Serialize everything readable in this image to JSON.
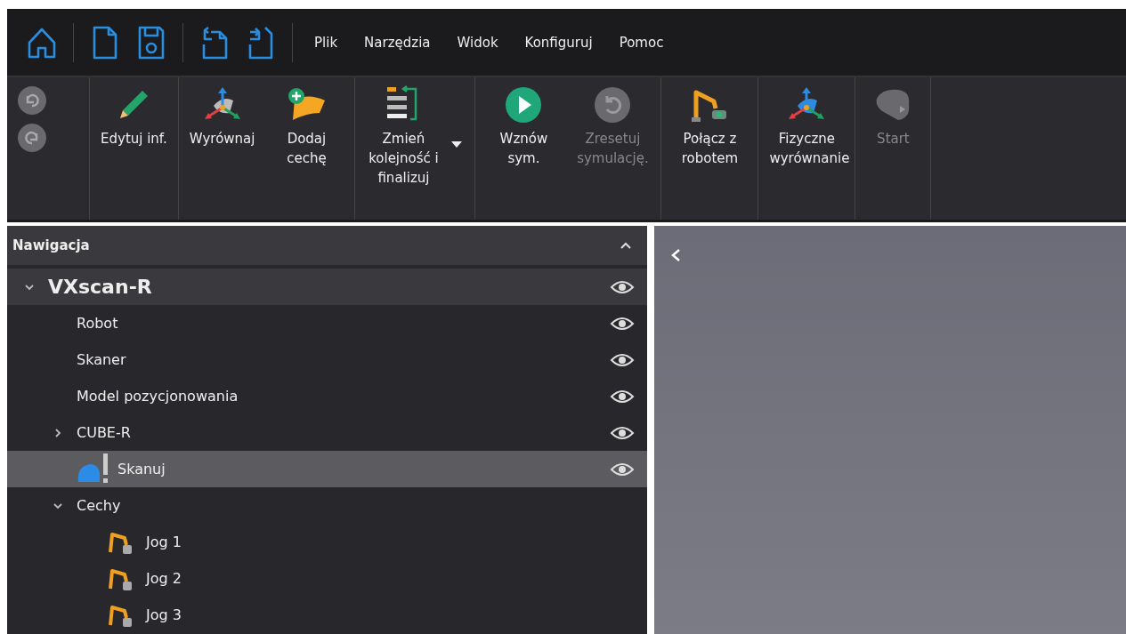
{
  "quick_access": [
    {
      "kind": "home"
    },
    {
      "kind": "new"
    },
    {
      "kind": "save"
    },
    {
      "kind": "undo-file"
    },
    {
      "kind": "redo-file"
    }
  ],
  "menu": [
    "Plik",
    "Narzędzia",
    "Widok",
    "Konfiguruj",
    "Pomoc"
  ],
  "history": [
    {
      "kind": "undo",
      "disabled": true
    },
    {
      "kind": "redo",
      "disabled": true
    }
  ],
  "ribbon": [
    {
      "buttons": [
        {
          "kind": "edit",
          "label": "Edytuj inf.",
          "disabled": false,
          "dropdown": false
        }
      ]
    },
    {
      "buttons": [
        {
          "kind": "align",
          "label": "Wyrównaj",
          "disabled": false,
          "dropdown": false
        },
        {
          "kind": "add-feature",
          "label": "Dodaj cechę",
          "disabled": false,
          "dropdown": false
        }
      ]
    },
    {
      "buttons": [
        {
          "kind": "reorder",
          "label": "Zmień kolejność i finalizuj",
          "disabled": false,
          "dropdown": true
        }
      ]
    },
    {
      "buttons": [
        {
          "kind": "play",
          "label": "Wznów sym.",
          "disabled": false,
          "dropdown": false
        },
        {
          "kind": "reset",
          "label": "Zresetuj symulację.",
          "disabled": true,
          "dropdown": false
        }
      ]
    },
    {
      "buttons": [
        {
          "kind": "robot",
          "label": "Połącz z robotem",
          "disabled": false,
          "dropdown": false
        }
      ]
    },
    {
      "buttons": [
        {
          "kind": "align-color",
          "label": "Fizyczne wyrównanie",
          "disabled": false,
          "dropdown": false
        }
      ]
    },
    {
      "buttons": [
        {
          "kind": "start",
          "label": "Start",
          "disabled": true,
          "dropdown": false
        }
      ]
    }
  ],
  "navigation": {
    "title": "Nawigacja",
    "expanded": true,
    "tree": [
      {
        "label": "VXscan-R",
        "kind": "root",
        "expanded": true,
        "selected": false,
        "eye": true,
        "children": [
          {
            "label": "Robot",
            "kind": "plain",
            "selected": false,
            "eye": true
          },
          {
            "label": "Skaner",
            "kind": "plain",
            "selected": false,
            "eye": true
          },
          {
            "label": "Model pozycjonowania",
            "kind": "plain",
            "selected": false,
            "eye": true
          },
          {
            "label": "CUBE-R",
            "kind": "plain",
            "expanded": false,
            "selected": false,
            "eye": true
          },
          {
            "label": "Skanuj",
            "kind": "scan",
            "selected": true,
            "eye": true
          },
          {
            "label": "Cechy",
            "kind": "plain",
            "expanded": true,
            "selected": false,
            "eye": false,
            "children": [
              {
                "label": "Jog 1",
                "kind": "jog",
                "selected": false,
                "eye": false
              },
              {
                "label": "Jog 2",
                "kind": "jog",
                "selected": false,
                "eye": false
              },
              {
                "label": "Jog 3",
                "kind": "jog",
                "selected": false,
                "eye": false
              }
            ]
          }
        ]
      }
    ]
  },
  "viewport": {
    "panel_collapsed": false
  }
}
